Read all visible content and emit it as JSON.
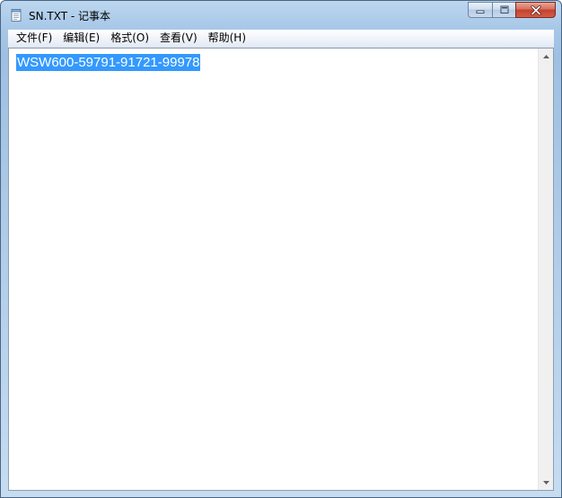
{
  "window": {
    "title": "SN.TXT - 记事本"
  },
  "icons": {
    "app": "notepad-icon",
    "minimize": "minimize-icon",
    "maximize": "maximize-icon",
    "close": "close-icon",
    "scroll_up": "chevron-up-icon",
    "scroll_down": "chevron-down-icon"
  },
  "menu": {
    "items": [
      {
        "label": "文件(F)"
      },
      {
        "label": "编辑(E)"
      },
      {
        "label": "格式(O)"
      },
      {
        "label": "查看(V)"
      },
      {
        "label": "帮助(H)"
      }
    ]
  },
  "editor": {
    "content": "WSW600-59791-91721-99978",
    "selection_color": "#3399ff"
  },
  "colors": {
    "frame": "#a8c8e8",
    "close_button": "#c2412c"
  }
}
